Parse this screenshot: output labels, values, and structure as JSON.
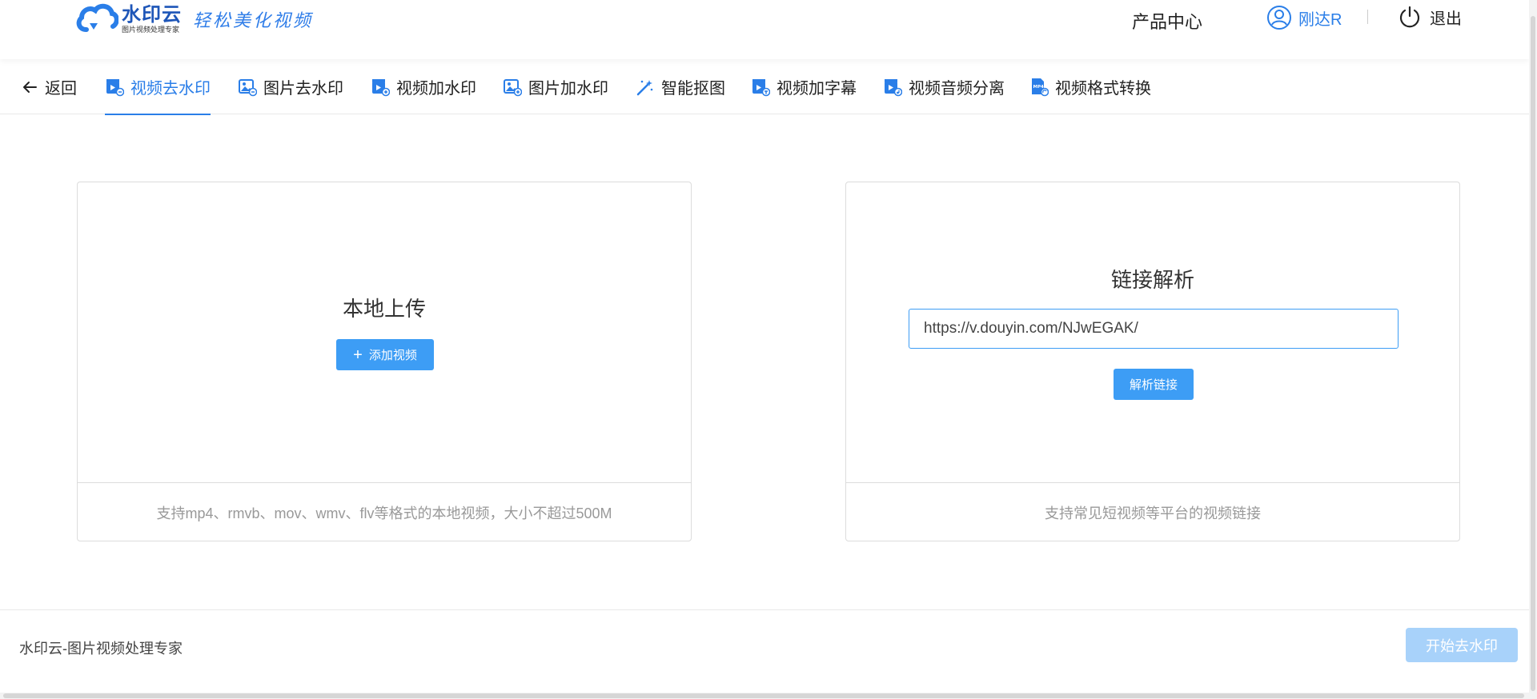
{
  "header": {
    "logo_name": "水印云",
    "logo_sub": "图片视频处理专家",
    "slogan": "轻松美化视频",
    "product_center": "产品中心",
    "username": "刚达R",
    "logout": "退出"
  },
  "tabs": {
    "back": "返回",
    "items": [
      {
        "label": "视频去水印",
        "icon": "video-edit-icon",
        "active": true
      },
      {
        "label": "图片去水印",
        "icon": "image-remove-icon",
        "active": false
      },
      {
        "label": "视频加水印",
        "icon": "video-add-icon",
        "active": false
      },
      {
        "label": "图片加水印",
        "icon": "image-add-icon",
        "active": false
      },
      {
        "label": "智能抠图",
        "icon": "magic-wand-icon",
        "active": false
      },
      {
        "label": "视频加字幕",
        "icon": "video-subtitle-icon",
        "active": false
      },
      {
        "label": "视频音频分离",
        "icon": "video-audio-icon",
        "active": false
      },
      {
        "label": "视频格式转换",
        "icon": "mp4-file-icon",
        "active": false
      }
    ]
  },
  "upload": {
    "title": "本地上传",
    "button": "添加视频",
    "hint": "支持mp4、rmvb、mov、wmv、flv等格式的本地视频，大小不超过500M"
  },
  "link": {
    "title": "链接解析",
    "input_value": "https://v.douyin.com/NJwEGAK/",
    "button": "解析链接",
    "hint": "支持常见短视频等平台的视频链接"
  },
  "footer": {
    "text": "水印云-图片视频处理专家",
    "start_button": "开始去水印"
  },
  "colors": {
    "accent": "#2a7ee8",
    "button": "#3d9df5",
    "button_disabled": "#a8d2fa"
  }
}
